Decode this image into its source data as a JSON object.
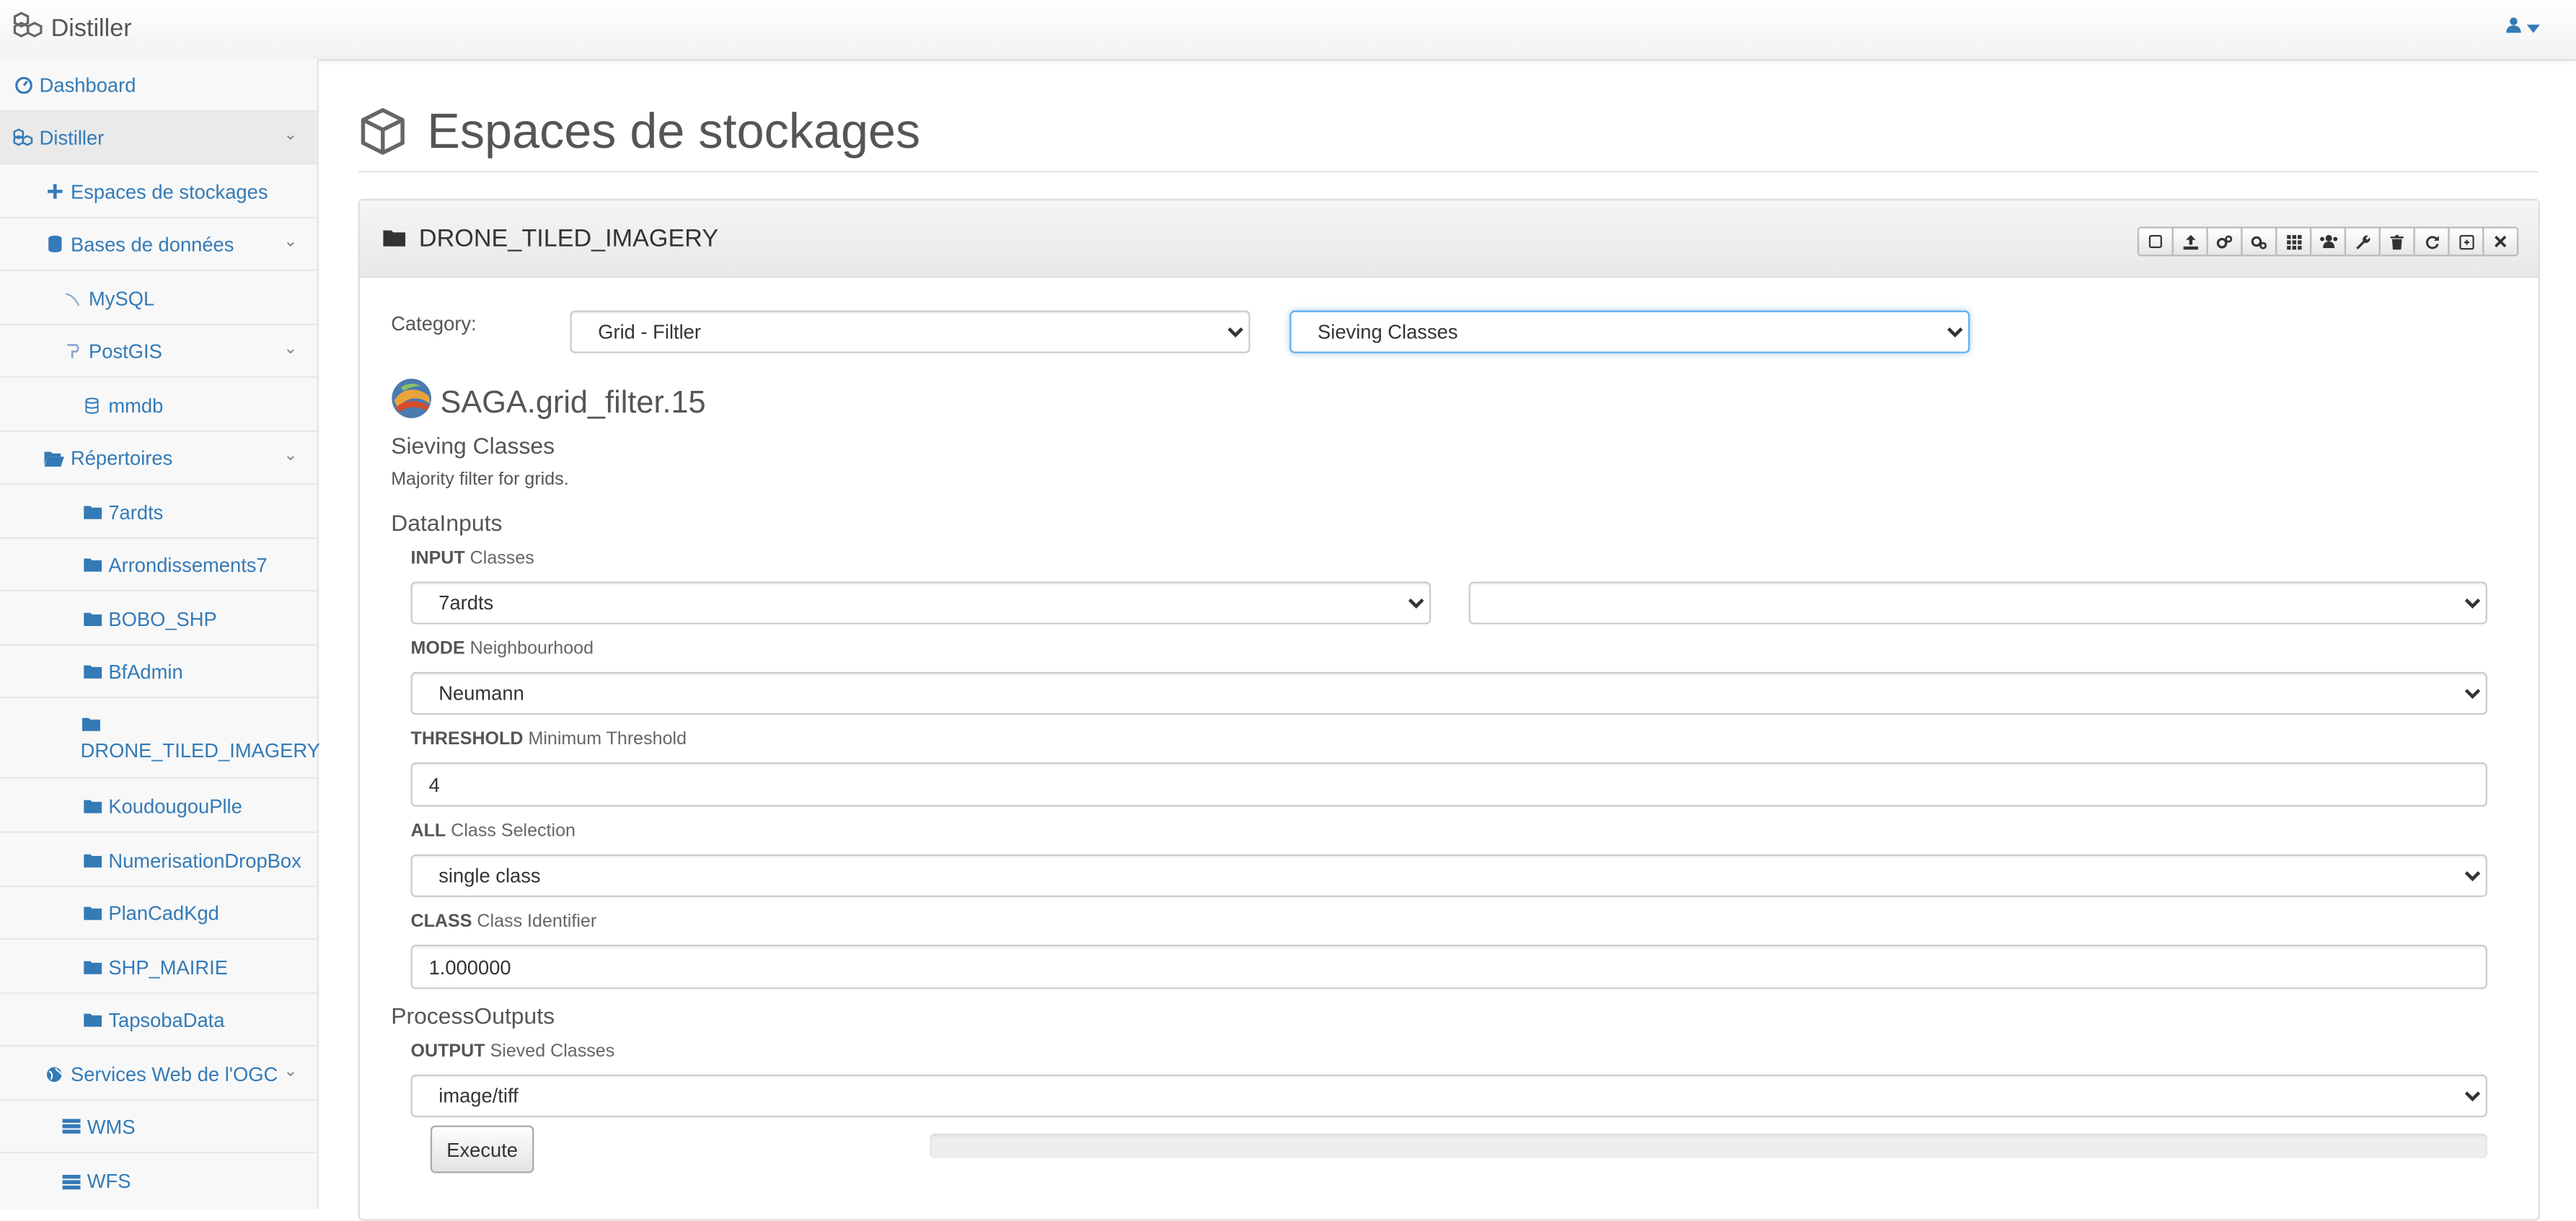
{
  "app": {
    "brand": "Distiller"
  },
  "sidebar": {
    "dashboard": "Dashboard",
    "distiller": "Distiller",
    "espaces": "Espaces de stockages",
    "bases": "Bases de données",
    "mysql": "MySQL",
    "postgis": "PostGIS",
    "mmdb": "mmdb",
    "repertoires": "Répertoires",
    "folders": [
      "7ardts",
      "Arrondissements7",
      "BOBO_SHP",
      "BfAdmin",
      "DRONE_TILED_IMAGERY",
      "KoudougouPlle",
      "NumerisationDropBox",
      "PlanCadKgd",
      "SHP_MAIRIE",
      "TapsobaData"
    ],
    "ogc": "Services Web de l'OGC",
    "wms": "WMS",
    "wfs": "WFS"
  },
  "page": {
    "title": "Espaces de stockages"
  },
  "panel": {
    "title": "DRONE_TILED_IMAGERY",
    "toolbar_icons": [
      "square-icon",
      "upload-icon",
      "cogs-icon",
      "cogs-alt-icon",
      "grid-icon",
      "users-icon",
      "wrench-icon",
      "trash-icon",
      "refresh-icon",
      "export-icon",
      "close-icon"
    ]
  },
  "form": {
    "category_label": "Category:",
    "category_value": "Grid - Filtler",
    "tool_value": "Sieving Classes",
    "process_id": "SAGA.grid_filter.15",
    "process_name": "Sieving Classes",
    "description": "Majority filter for grids.",
    "datainputs_heading": "DataInputs",
    "input": {
      "key": "INPUT",
      "label": "Classes",
      "value": "7ardts",
      "value2": ""
    },
    "mode": {
      "key": "MODE",
      "label": "Neighbourhood",
      "value": "Neumann"
    },
    "threshold": {
      "key": "THRESHOLD",
      "label": "Minimum Threshold",
      "value": "4"
    },
    "all": {
      "key": "ALL",
      "label": "Class Selection",
      "value": "single class"
    },
    "class": {
      "key": "CLASS",
      "label": "Class Identifier",
      "value": "1.000000"
    },
    "outputs_heading": "ProcessOutputs",
    "output": {
      "key": "OUTPUT",
      "label": "Sieved Classes",
      "value": "image/tiff"
    },
    "execute_label": "Execute",
    "progress": 0
  },
  "colors": {
    "link": "#337ab7",
    "focus": "#66afe9"
  }
}
